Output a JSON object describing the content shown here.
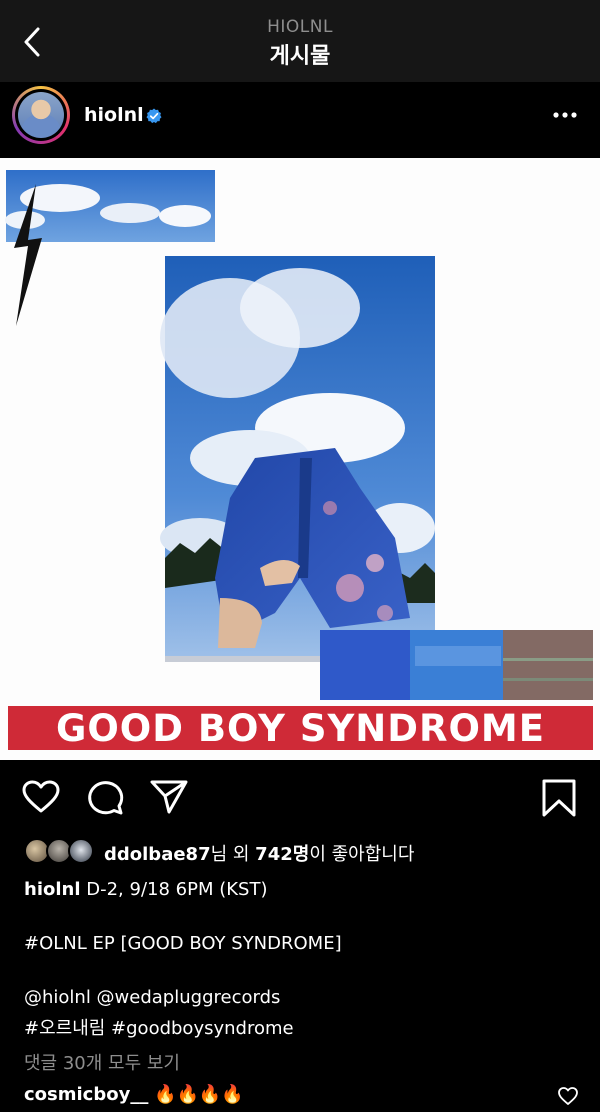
{
  "nav": {
    "account_label": "HIOLNL",
    "title": "게시물"
  },
  "post": {
    "username": "hiolnl",
    "image_text": "GOOD BOY SYNDROME",
    "likes": {
      "liker": "ddolbae87",
      "suffix_a": "님 외 ",
      "count": "742명",
      "suffix_b": "이 좋아합니다"
    },
    "caption": {
      "author": "hiolnl",
      "line1": "D-2, 9/18 6PM (KST)",
      "line2": "#OLNL EP [GOOD BOY SYNDROME]",
      "line3": "@hiolnl @wedapluggrecords",
      "line4": "#오르내림 #goodboysyndrome"
    },
    "view_comments": "댓글 30개 모두 보기",
    "comment": {
      "author": "cosmicboy__",
      "text": "🔥🔥🔥🔥"
    }
  },
  "colors": {
    "background": "#000000",
    "nav_bg": "#161616",
    "verified": "#3897f0",
    "banner_red": "#cf2a37",
    "muted_text": "#8e8e8e"
  },
  "icons": [
    "back-chevron-icon",
    "verified-badge-icon",
    "more-dots-icon",
    "heart-icon",
    "comment-bubble-icon",
    "share-send-icon",
    "bookmark-icon"
  ]
}
